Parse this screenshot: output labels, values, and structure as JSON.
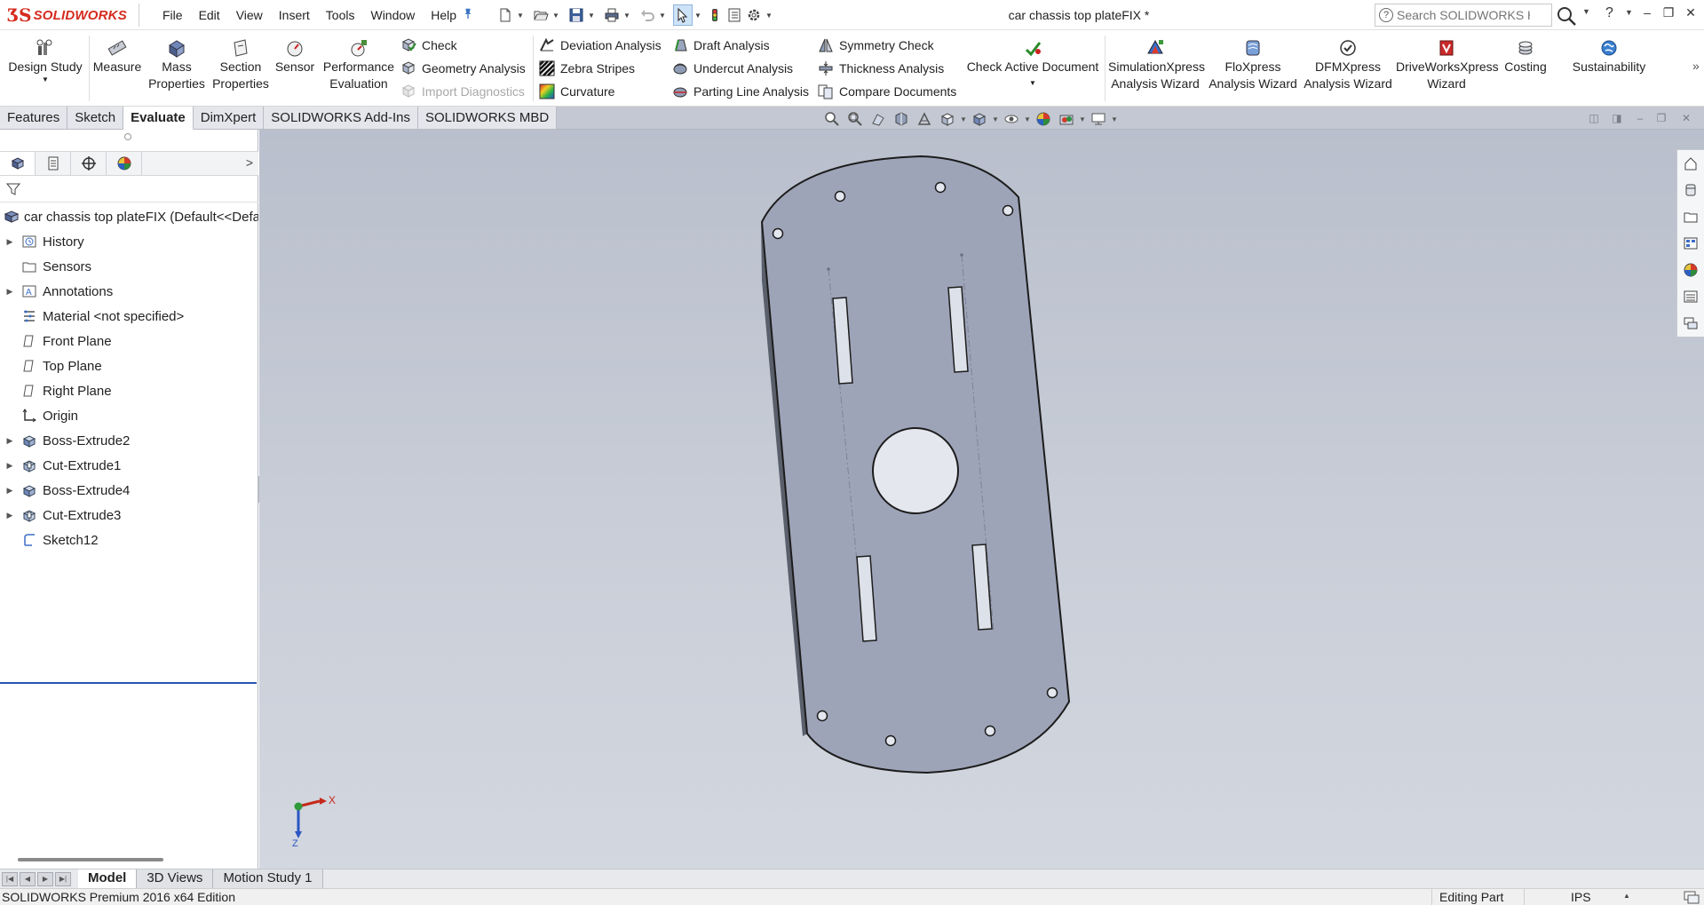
{
  "app": {
    "brand": "SOLIDWORKS",
    "document_title": "car chassis top plateFIX *"
  },
  "menu": [
    "File",
    "Edit",
    "View",
    "Insert",
    "Tools",
    "Window",
    "Help"
  ],
  "search": {
    "placeholder": "Search SOLIDWORKS Help"
  },
  "command_manager": {
    "design_study": "Design Study",
    "measure": "Measure",
    "mass_properties": [
      "Mass",
      "Properties"
    ],
    "section_properties": [
      "Section",
      "Properties"
    ],
    "sensor": "Sensor",
    "performance_evaluation": [
      "Performance",
      "Evaluation"
    ],
    "check": "Check",
    "geometry_analysis": "Geometry Analysis",
    "import_diagnostics": "Import Diagnostics",
    "deviation_analysis": "Deviation Analysis",
    "zebra_stripes": "Zebra Stripes",
    "curvature": "Curvature",
    "draft_analysis": "Draft Analysis",
    "undercut_analysis": "Undercut Analysis",
    "parting_line_analysis": "Parting Line Analysis",
    "symmetry_check": "Symmetry Check",
    "thickness_analysis": "Thickness Analysis",
    "compare_documents": "Compare Documents",
    "check_active_document": "Check Active Document",
    "simulationxpress": [
      "SimulationXpress",
      "Analysis Wizard"
    ],
    "floxpress": [
      "FloXpress",
      "Analysis Wizard"
    ],
    "dfmxpress": [
      "DFMXpress",
      "Analysis Wizard"
    ],
    "driveworksxpress": [
      "DriveWorksXpress",
      "Wizard"
    ],
    "costing": "Costing",
    "sustainability": "Sustainability"
  },
  "tabs": [
    "Features",
    "Sketch",
    "Evaluate",
    "DimXpert",
    "SOLIDWORKS Add-Ins",
    "SOLIDWORKS MBD"
  ],
  "active_tab": "Evaluate",
  "feature_tree": {
    "root": "car chassis top plateFIX  (Default<<Defa",
    "items": [
      {
        "label": "History",
        "expandable": true,
        "icon": "history-folder-icon"
      },
      {
        "label": "Sensors",
        "expandable": false,
        "icon": "sensors-folder-icon"
      },
      {
        "label": "Annotations",
        "expandable": true,
        "icon": "annotations-icon"
      },
      {
        "label": "Material <not specified>",
        "expandable": false,
        "icon": "material-icon"
      },
      {
        "label": "Front Plane",
        "expandable": false,
        "icon": "plane-icon"
      },
      {
        "label": "Top Plane",
        "expandable": false,
        "icon": "plane-icon"
      },
      {
        "label": "Right Plane",
        "expandable": false,
        "icon": "plane-icon"
      },
      {
        "label": "Origin",
        "expandable": false,
        "icon": "origin-icon"
      },
      {
        "label": "Boss-Extrude2",
        "expandable": true,
        "icon": "boss-extrude-icon"
      },
      {
        "label": "Cut-Extrude1",
        "expandable": true,
        "icon": "cut-extrude-icon"
      },
      {
        "label": "Boss-Extrude4",
        "expandable": true,
        "icon": "boss-extrude-icon"
      },
      {
        "label": "Cut-Extrude3",
        "expandable": true,
        "icon": "cut-extrude-icon"
      },
      {
        "label": "Sketch12",
        "expandable": false,
        "icon": "sketch-icon"
      }
    ]
  },
  "triad": {
    "x_label": "X",
    "z_label": "Z"
  },
  "bottom_tabs": [
    "Model",
    "3D Views",
    "Motion Study 1"
  ],
  "active_bottom_tab": "Model",
  "status": {
    "edition": "SOLIDWORKS Premium 2016 x64 Edition",
    "mode": "Editing Part",
    "units": "IPS"
  },
  "colors": {
    "brand_red": "#d52b1e",
    "part_face": "#9ea4b8",
    "viewport_top": "#b9bfcc",
    "viewport_bottom": "#d3d7df",
    "rollback_bar": "#2a55b0"
  }
}
